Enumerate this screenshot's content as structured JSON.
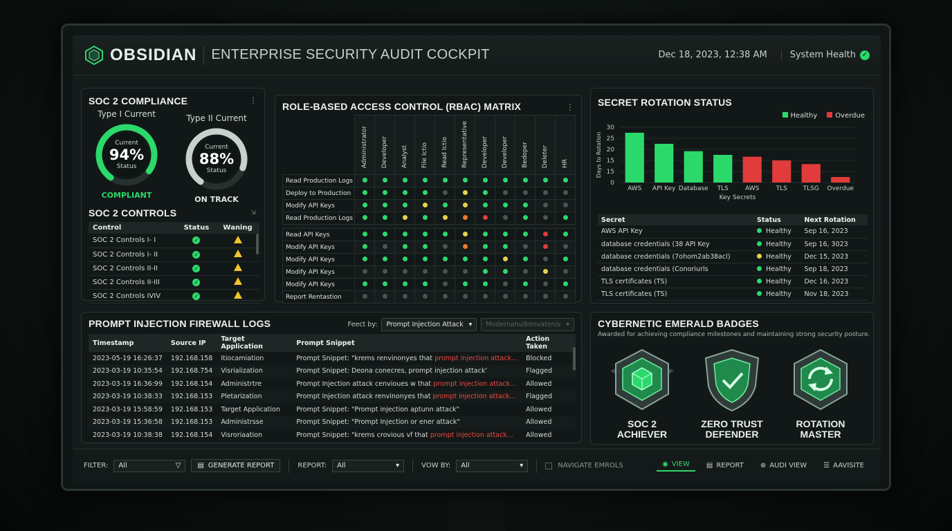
{
  "header": {
    "brand": "OBSIDIAN",
    "title": "ENTERPRISE SECURITY AUDIT COCKPIT",
    "datetime": "Dec 18, 2023, 12:38 AM",
    "health_label": "System Health"
  },
  "soc2": {
    "title": "SOC 2 COMPLIANCE",
    "gauges": [
      {
        "label": "Type I Current",
        "top": "Current",
        "value": "94%",
        "bottom": "Status",
        "status": "COMPLIANT",
        "fraction": 0.94,
        "color": "#2bd96b"
      },
      {
        "label": "Type II Current",
        "top": "Current",
        "value": "88%",
        "bottom": "Status",
        "status": "ON TRACK",
        "fraction": 0.88,
        "color": "#c9d1ce"
      }
    ],
    "controls_title": "SOC 2 CONTROLS",
    "columns": [
      "Control",
      "Status",
      "Waning"
    ],
    "rows": [
      "SOC 2 Controls I- I",
      "SOC 2 Controls I- II",
      "SOC 2 Controls II-II",
      "SOC 2 Controls II-III",
      "SOC 2 Controls IVIV"
    ]
  },
  "rbac": {
    "title": "ROLE-BASED ACCESS CONTROL (RBAC) MATRIX",
    "roles": [
      "Administrator",
      "Developer",
      "Analyst",
      "File Ictio",
      "Read Ictio",
      "Representative",
      "Developer",
      "Developer",
      "Bedoper",
      "Deleter",
      "HR"
    ],
    "rows": [
      {
        "label": "Read Production Logs",
        "cells": [
          "g",
          "g",
          "g",
          "g",
          "g",
          "g",
          "g",
          "g",
          "g",
          "g",
          "g"
        ]
      },
      {
        "label": "Deploy to Production",
        "cells": [
          "g",
          "g",
          "g",
          "g",
          "n",
          "y",
          "g",
          "n",
          "n",
          "n",
          "n"
        ]
      },
      {
        "label": "Modify API Keys",
        "cells": [
          "g",
          "g",
          "g",
          "y",
          "g",
          "y",
          "g",
          "g",
          "g",
          "n",
          "n"
        ]
      },
      {
        "label": "Read Production Logs",
        "cells": [
          "g",
          "g",
          "y",
          "g",
          "y",
          "o",
          "r",
          "n",
          "g",
          "n",
          "g"
        ]
      },
      {
        "label": "Read API Keys",
        "cells": [
          "g",
          "g",
          "g",
          "g",
          "g",
          "y",
          "g",
          "g",
          "g",
          "r",
          "g"
        ]
      },
      {
        "label": "Modify API Keys",
        "cells": [
          "g",
          "n",
          "g",
          "g",
          "n",
          "o",
          "g",
          "g",
          "n",
          "r",
          "n"
        ]
      },
      {
        "label": "Modify API Keys",
        "cells": [
          "g",
          "g",
          "g",
          "g",
          "g",
          "g",
          "g",
          "y",
          "g",
          "n",
          "g"
        ]
      },
      {
        "label": "Modify API Keys",
        "cells": [
          "n",
          "n",
          "n",
          "n",
          "n",
          "n",
          "g",
          "g",
          "n",
          "y",
          "n"
        ]
      },
      {
        "label": "Modify API Keys",
        "cells": [
          "g",
          "g",
          "g",
          "g",
          "n",
          "g",
          "g",
          "n",
          "g",
          "n",
          "g"
        ]
      },
      {
        "label": "Report Rentastion",
        "cells": [
          "n",
          "n",
          "n",
          "n",
          "n",
          "n",
          "n",
          "n",
          "n",
          "n",
          "n"
        ]
      }
    ]
  },
  "secrets": {
    "title": "SECRET ROTATION STATUS",
    "legend": {
      "healthy": "Healthy",
      "overdue": "Overdue"
    },
    "columns": [
      "Secret",
      "Status",
      "Next Rotation"
    ],
    "rows": [
      {
        "secret": "AWS API Key",
        "status": "Healthy",
        "next": "Sep 16, 2023",
        "dot": "#2bd96b"
      },
      {
        "secret": "database credentials (38 API Key",
        "status": "Healthy",
        "next": "Sep 16, 3023",
        "dot": "#2bd96b"
      },
      {
        "secret": "database credentials (7ohom2ab38acl)",
        "status": "Healthy",
        "next": "Dec 15, 2023",
        "dot": "#e6d34a"
      },
      {
        "secret": "database credentials (Conoriurls",
        "status": "Healthy",
        "next": "Sep 18, 2023",
        "dot": "#2bd96b"
      },
      {
        "secret": "TLS certificates (TS)",
        "status": "Healthy",
        "next": "Dec 16, 2023",
        "dot": "#2bd96b"
      },
      {
        "secret": "TLS certificates (TS)",
        "status": "Healthy",
        "next": "Nov 18, 2023",
        "dot": "#2bd96b"
      }
    ]
  },
  "chart_data": {
    "type": "bar",
    "categories": [
      "AWS",
      "API Key",
      "Database",
      "TLS",
      "AWS",
      "TLS",
      "TLSG",
      "Overdue"
    ],
    "values": [
      27,
      21,
      17,
      15,
      14,
      12,
      10,
      3
    ],
    "colors": [
      "#2bd96b",
      "#2bd96b",
      "#2bd96b",
      "#2bd96b",
      "#e23b3b",
      "#e23b3b",
      "#e23b3b",
      "#e23b3b"
    ],
    "series_legend": [
      "Healthy",
      "Overdue"
    ],
    "xlabel": "Key Secrets",
    "ylabel": "Days to Rotation",
    "yticks": [
      "0",
      "15",
      "15",
      "20",
      "25",
      "30"
    ],
    "ylim": [
      0,
      30
    ],
    "grid": true,
    "legend": "top-right"
  },
  "logs": {
    "title": "PROMPT INJECTION FIREWALL LOGS",
    "filter_label": "Feect by:",
    "filter_value": "Prompt Injection Attack",
    "filter2_value": "Modernahulkenvatenis",
    "columns": [
      "Timestamp",
      "Source IP",
      "Target Application",
      "Prompt Snippet",
      "Action Taken"
    ],
    "rows": [
      {
        "ts": "2023-05-19 16:26:37",
        "ip": "192.168.158",
        "app": "Itiocamiation",
        "snip": "Prompt Snippet: \"krems renvinonyes that ",
        "hl": "prompt injection attack...",
        "action": "Blocked",
        "cls": "red"
      },
      {
        "ts": "2023-03-19 10:35:54",
        "ip": "192.168.754",
        "app": "Visrialization",
        "snip": "Prompt Snippet: Deona conecres, prompt injection attack'",
        "hl": "",
        "action": "Flagged",
        "cls": "amber"
      },
      {
        "ts": "2023-03-19 16:36:99",
        "ip": "192.168.154",
        "app": "Administrtre",
        "snip": "Prompt Injection attack cenvioues w that ",
        "hl": "prompt injection attack...",
        "action": "Allowed",
        "cls": "green"
      },
      {
        "ts": "2023-03-19 10:38:33",
        "ip": "192.168.153",
        "app": "Pletarization",
        "snip": "Prompt Injection attack renvinonyes that ",
        "hl": "prompt injection attack...",
        "action": "Flagged",
        "cls": "amber"
      },
      {
        "ts": "2023-03-19 15:58:59",
        "ip": "192.168.153",
        "app": "Target Application",
        "snip": "Prompt Snippet: \"Prompt injection aptunn attack\"",
        "hl": "",
        "action": "Allowed",
        "cls": "green"
      },
      {
        "ts": "2023-03-19 15:36:58",
        "ip": "192.168.153",
        "app": "Administrsse",
        "snip": "Prompt Snippet: \"Prompt Injection or ener attack\"",
        "hl": "",
        "action": "Allowed",
        "cls": "green"
      },
      {
        "ts": "2023-03-19 10:38:38",
        "ip": "192.168.154",
        "app": "Visroriaation",
        "snip": "Prompt Snippet: \"krems crovious vf that ",
        "hl": "prompt injection attack...",
        "action": "Allowed",
        "cls": "green"
      }
    ]
  },
  "badges": {
    "title": "CYBERNETIC EMERALD BADGES",
    "subtitle": "Awarded for achieving compliance milestones and maintaining strong security posture.",
    "items": [
      {
        "l1": "SOC 2",
        "l2": "ACHIEVER"
      },
      {
        "l1": "ZERO TRUST",
        "l2": "DEFENDER"
      },
      {
        "l1": "ROTATION",
        "l2": "MASTER"
      }
    ]
  },
  "bottombar": {
    "filter_label": "FILTER:",
    "filter_value": "All",
    "generate": "GENERATE REPORT",
    "report_label": "REPORT:",
    "report_value": "All",
    "view_label": "VOW BY:",
    "view_value": "All",
    "navigate": "NAVIGATE EMROLS",
    "nav": [
      "VIEW",
      "REPORT",
      "AUDI VIEW",
      "AAVISITE"
    ]
  }
}
